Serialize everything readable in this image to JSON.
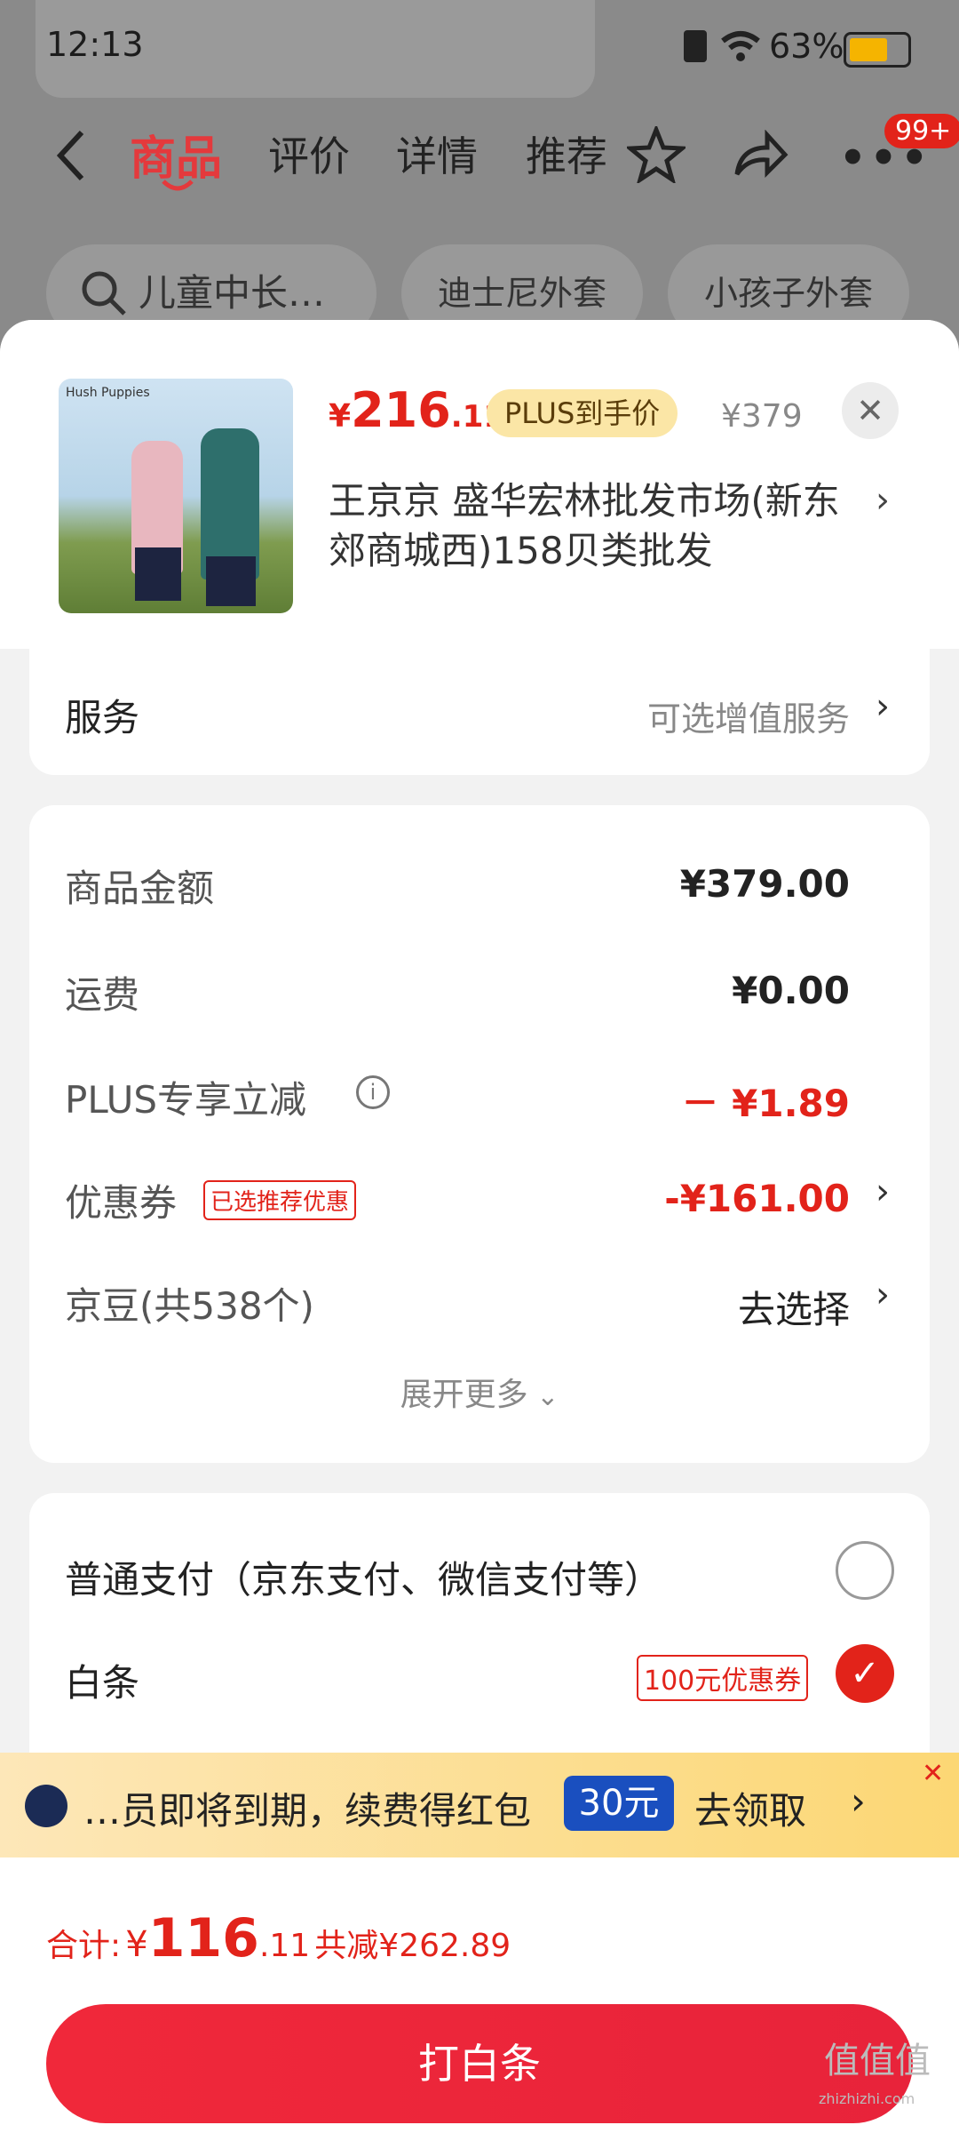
{
  "status_bar": {
    "time": "12:13",
    "battery": "63%"
  },
  "nav": {
    "tabs": [
      "商品",
      "评价",
      "详情",
      "推荐"
    ],
    "active_tab": "商品",
    "more_badge": "99+"
  },
  "search": {
    "query": "儿童中长…",
    "chips": [
      "迪士尼外套",
      "小孩子外套"
    ]
  },
  "product": {
    "price_symbol": "¥",
    "price_int": "216",
    "price_dec": ".11",
    "plus_tag": "PLUS到手价",
    "original_price": "¥379",
    "shop_name": "王京京  盛华宏林批发市场(新东郊商城西)158贝类批发",
    "thumb_brand": "Hush Puppies"
  },
  "service": {
    "label": "服务",
    "hint": "可选增值服务"
  },
  "cost": {
    "rows": [
      {
        "label": "商品金额",
        "value": "¥379.00"
      },
      {
        "label": "运费",
        "value": "¥0.00"
      },
      {
        "label": "PLUS专享立减",
        "value": "－ ¥1.89"
      },
      {
        "label": "优惠券",
        "tag": "已选推荐优惠",
        "value": "-¥161.00"
      },
      {
        "label": "京豆(共538个)",
        "value": "去选择"
      }
    ],
    "expand": "展开更多"
  },
  "payment": {
    "options": [
      {
        "label": "普通支付（京东支付、微信支付等）",
        "selected": false
      },
      {
        "label": "白条",
        "tag": "100元优惠券",
        "selected": true
      }
    ]
  },
  "banner": {
    "text": "…员即将到期，续费得红包",
    "amount": "30元",
    "action": "去领取"
  },
  "footer": {
    "total_label": "合计:",
    "total_symbol": "¥",
    "total_int": "116",
    "total_dec": ".11",
    "saved": "共减¥262.89",
    "pay_button": "打白条"
  },
  "watermark": "值值值",
  "watermark_url": "zhizhizhi.com",
  "colors": {
    "accent": "#e2231a",
    "plus_gold": "#fbe6a6",
    "banner_btn": "#1a4fbf"
  }
}
